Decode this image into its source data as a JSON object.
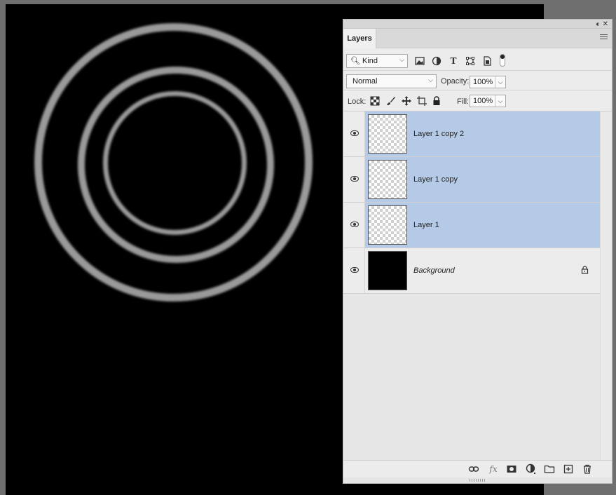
{
  "panel": {
    "collapse_label": "‹‹",
    "close_label": "✕",
    "tab_title": "Layers"
  },
  "filter": {
    "kind_label": "Kind",
    "icons": [
      "image-filter-icon",
      "adjustment-filter-icon",
      "type-filter-icon",
      "shape-filter-icon",
      "smart-object-filter-icon"
    ]
  },
  "blend": {
    "mode": "Normal",
    "opacity_label": "Opacity:",
    "opacity_value": "100%"
  },
  "lock": {
    "label": "Lock:",
    "fill_label": "Fill:",
    "fill_value": "100%"
  },
  "layers": [
    {
      "name": "Layer 1 copy 2",
      "selected": true,
      "visible": true
    },
    {
      "name": "Layer 1 copy",
      "selected": true,
      "visible": true
    },
    {
      "name": "Layer 1",
      "selected": true,
      "visible": true
    },
    {
      "name": "Background",
      "selected": false,
      "visible": true,
      "locked": true
    }
  ],
  "colors": {
    "selection": "#b4cae7",
    "canvas": "#000000",
    "ring": "#9a9a9a"
  }
}
